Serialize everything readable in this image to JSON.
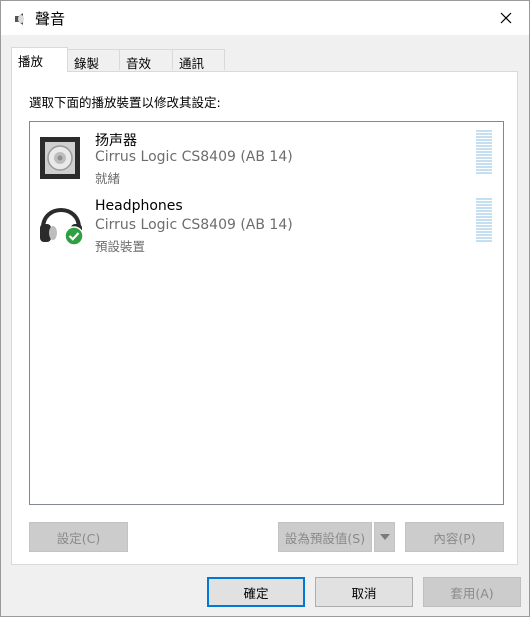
{
  "window": {
    "title": "聲音"
  },
  "tabs": [
    {
      "label": "播放",
      "active": true
    },
    {
      "label": "錄製",
      "active": false
    },
    {
      "label": "音效",
      "active": false
    },
    {
      "label": "通訊",
      "active": false
    }
  ],
  "playback": {
    "instruction": "選取下面的播放裝置以修改其設定:",
    "devices": [
      {
        "name": "扬声器",
        "driver": "Cirrus Logic CS8409 (AB 14)",
        "status": "就緒",
        "icon": "speaker-icon",
        "is_default": false
      },
      {
        "name": "Headphones",
        "driver": "Cirrus Logic CS8409 (AB 14)",
        "status": "預設裝置",
        "icon": "headphones-icon",
        "is_default": true
      }
    ],
    "buttons": {
      "configure": "設定(C)",
      "set_default": "設為預設值(S)",
      "properties": "內容(P)"
    }
  },
  "footer": {
    "ok": "確定",
    "cancel": "取消",
    "apply": "套用(A)"
  },
  "colors": {
    "accent": "#0078d7",
    "meter": "#c4dfef",
    "check": "#2ea043"
  }
}
